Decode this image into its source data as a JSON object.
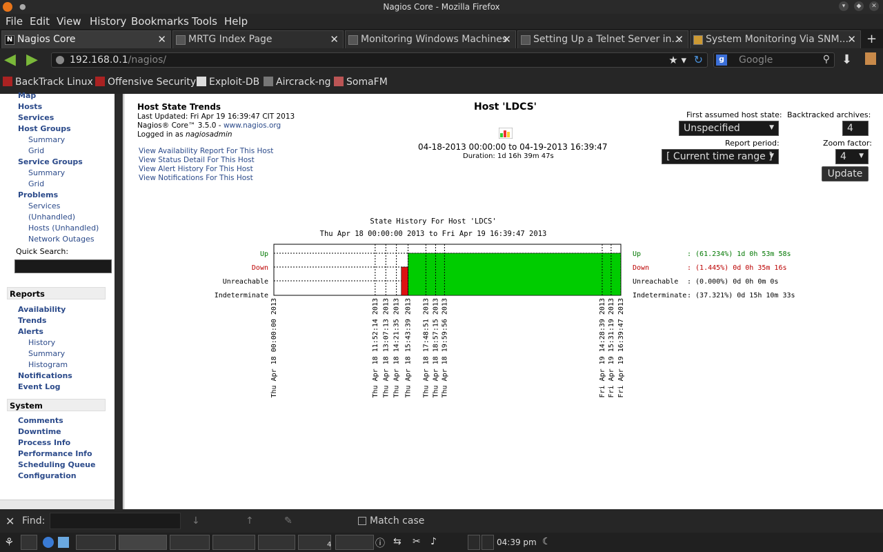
{
  "window": {
    "title": "Nagios Core - Mozilla Firefox"
  },
  "menubar": [
    "File",
    "Edit",
    "View",
    "History",
    "Bookmarks",
    "Tools",
    "Help"
  ],
  "tabs": [
    "Nagios Core",
    "MRTG Index Page",
    "Monitoring Windows Machines",
    "Setting Up a Telnet Server in...",
    "System Monitoring Via SNM..."
  ],
  "url": {
    "host": "192.168.0.1",
    "path": "/nagios/"
  },
  "search": {
    "placeholder": "Google"
  },
  "bookmarks": [
    "BackTrack Linux",
    "Offensive Security",
    "Exploit-DB",
    "Aircrack-ng",
    "SomaFM"
  ],
  "sidebar": {
    "top": [
      "Map",
      "Hosts",
      "Services",
      "Host Groups",
      "Summary",
      "Grid",
      "Service Groups",
      "Summary",
      "Grid",
      "Problems",
      "Services",
      "(Unhandled)",
      "Hosts (Unhandled)",
      "Network Outages"
    ],
    "quick_search_label": "Quick Search:",
    "reports_header": "Reports",
    "reports": [
      "Availability",
      "Trends",
      "Alerts",
      "History",
      "Summary",
      "Histogram",
      "Notifications",
      "Event Log"
    ],
    "system_header": "System",
    "system": [
      "Comments",
      "Downtime",
      "Process Info",
      "Performance Info",
      "Scheduling Queue",
      "Configuration"
    ]
  },
  "info": {
    "title": "Host State Trends",
    "updated": "Last Updated: Fri Apr 19 16:39:47 CIT 2013",
    "version": "Nagios® Core™ 3.5.0 - ",
    "site": "www.nagios.org",
    "logged": "Logged in as ",
    "user": "nagiosadmin",
    "links": [
      "View Availability Report For This Host",
      "View Status Detail For This Host",
      "View Alert History For This Host",
      "View Notifications For This Host"
    ]
  },
  "center": {
    "host": "Host 'LDCS'",
    "range": "04-18-2013 00:00:00 to 04-19-2013 16:39:47",
    "duration": "Duration: 1d 16h 39m 47s"
  },
  "form": {
    "assumed_label": "First assumed host state:",
    "assumed_value": "Unspecified",
    "period_label": "Report period:",
    "period_value": "[ Current time range ]",
    "archives_label": "Backtracked archives:",
    "archives_value": "4",
    "zoom_label": "Zoom factor:",
    "zoom_value": "4",
    "update": "Update"
  },
  "chart_data": {
    "type": "area",
    "title": "State History For Host 'LDCS'",
    "subtitle": "Thu Apr 18 00:00:00 2013 to Fri Apr 19 16:39:47 2013",
    "states": [
      "Up",
      "Down",
      "Unreachable",
      "Indeterminate"
    ],
    "state_colors": {
      "Up": "#00cc00",
      "Down": "#dd1111",
      "Unreachable": "#000000",
      "Indeterminate": "#000000"
    },
    "segments": [
      {
        "state": "Indeterminate",
        "start": "2013-04-18 00:00:00",
        "end": "2013-04-18 14:56:14"
      },
      {
        "state": "Down",
        "start": "2013-04-18 14:56:14",
        "end": "2013-04-18 15:43:39"
      },
      {
        "state": "Up",
        "start": "2013-04-18 15:43:39",
        "end": "2013-04-19 16:39:47"
      }
    ],
    "tick_labels": [
      "Thu Apr 18 00:00:00 2013",
      "Thu Apr 18 11:52:14 2013",
      "Thu Apr 18 13:07:13 2013",
      "Thu Apr 18 14:21:35 2013",
      "Thu Apr 18 15:43:39 2013",
      "Thu Apr 18 17:48:51 2013",
      "Thu Apr 18 18:57:15 2013",
      "Thu Apr 18 19:59:56 2013",
      "Fri Apr 19 14:28:39 2013",
      "Fri Apr 19 15:31:19 2013",
      "Fri Apr 19 16:39:47 2013"
    ],
    "summary": [
      {
        "state": "Up",
        "text": ": (61.234%) 1d 0h 53m 58s",
        "color": "#007700"
      },
      {
        "state": "Down",
        "text": ": (1.445%) 0d 0h 35m 16s",
        "color": "#bb0000"
      },
      {
        "state": "Unreachable",
        "text": ": (0.000%) 0d 0h 0m 0s",
        "color": "#000000"
      },
      {
        "state": "Indeterminate",
        "text": ": (37.321%) 0d 15h 10m 33s",
        "color": "#000000"
      }
    ]
  },
  "findbar": {
    "label": "Find:",
    "match_case": "Match case"
  },
  "taskbar": {
    "clock": "04:39 pm",
    "desktop": "4"
  }
}
